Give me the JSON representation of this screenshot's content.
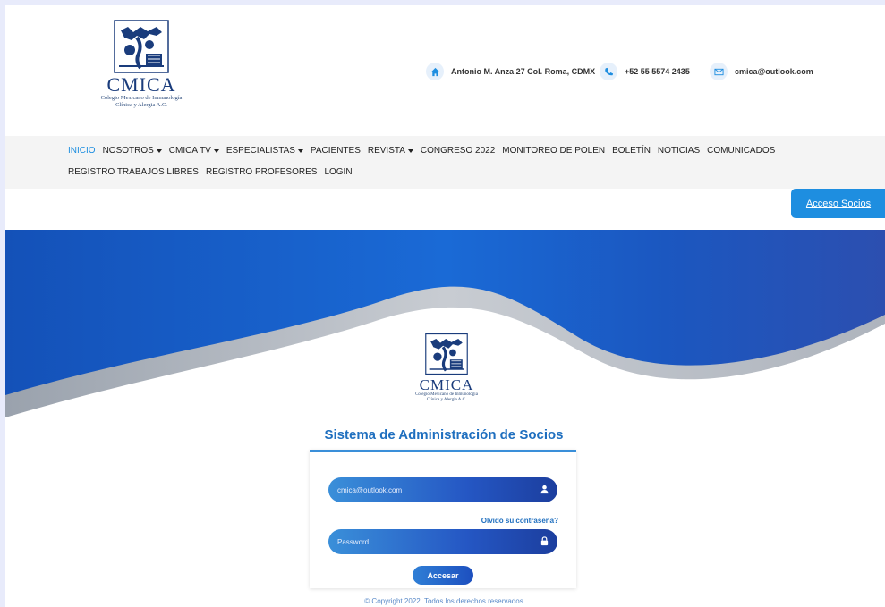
{
  "brand": {
    "name": "CMICA",
    "subtitle_line1": "Colegio Mexicano de Inmunología",
    "subtitle_line2": "Clínica y Alergia A.C."
  },
  "contact": {
    "address": "Antonio M. Anza 27 Col. Roma, CDMX",
    "phone": "+52 55 5574 2435",
    "email": "cmica@outlook.com"
  },
  "nav": {
    "row1": [
      {
        "label": "INICIO",
        "dropdown": false,
        "active": true
      },
      {
        "label": "NOSOTROS",
        "dropdown": true
      },
      {
        "label": "CMICA TV",
        "dropdown": true
      },
      {
        "label": "ESPECIALISTAS",
        "dropdown": true
      },
      {
        "label": "PACIENTES",
        "dropdown": false
      },
      {
        "label": "REVISTA",
        "dropdown": true
      },
      {
        "label": "CONGRESO 2022",
        "dropdown": false
      },
      {
        "label": "MONITOREO DE POLEN",
        "dropdown": false
      },
      {
        "label": "BOLETÍN",
        "dropdown": false
      },
      {
        "label": "NOTICIAS",
        "dropdown": false
      },
      {
        "label": "COMUNICADOS",
        "dropdown": false
      }
    ],
    "row2": [
      {
        "label": "REGISTRO TRABAJOS LIBRES"
      },
      {
        "label": "REGISTRO PROFESORES"
      },
      {
        "label": "LOGIN"
      }
    ]
  },
  "acceso_socios": "Acceso Socios",
  "login": {
    "title": "Sistema de Administración de Socios",
    "email_value": "cmica@outlook.com",
    "password_placeholder": "Password",
    "forgot": "Olvidó su contraseña?",
    "submit": "Accesar"
  },
  "footer": {
    "copyright": "© Copyright 2022. Todos los derechos reservados"
  },
  "colors": {
    "accent": "#1e8ee0",
    "hero_blue": "#1a55c2",
    "title_blue": "#1f6fbf"
  }
}
